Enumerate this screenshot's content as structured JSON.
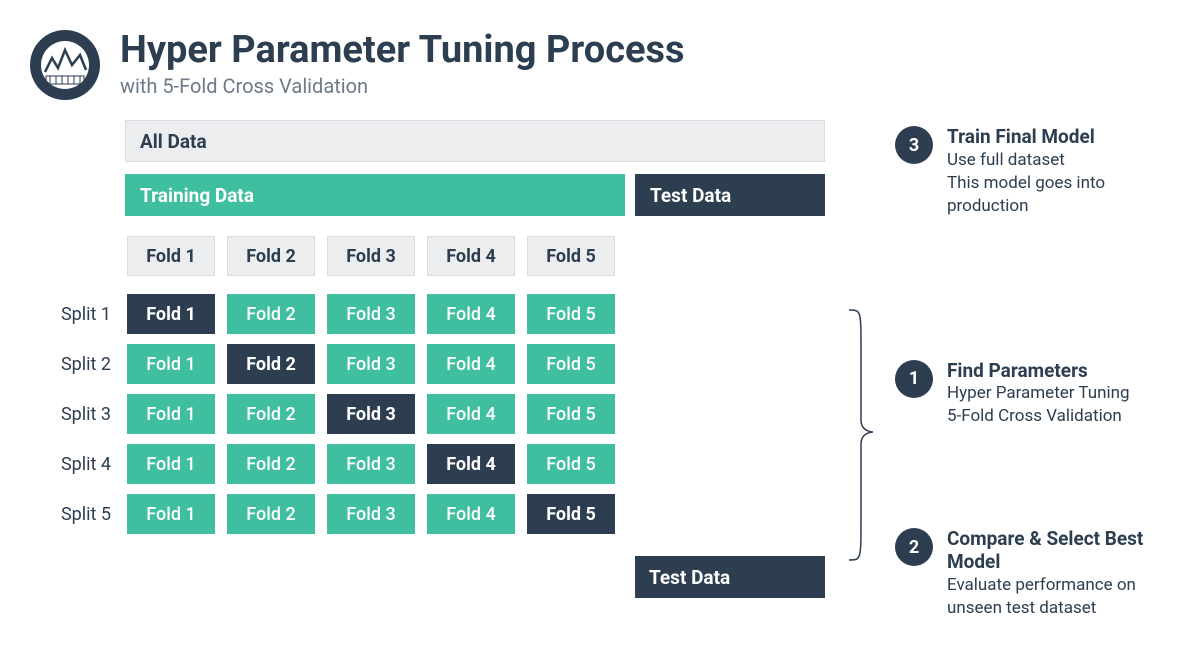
{
  "header": {
    "title": "Hyper Parameter Tuning Process",
    "subtitle": "with 5-Fold Cross Validation"
  },
  "rows": {
    "all_data": "All Data",
    "training_data": "Training Data",
    "test_data": "Test Data",
    "fold_headers": [
      "Fold 1",
      "Fold 2",
      "Fold 3",
      "Fold 4",
      "Fold 5"
    ],
    "splits": [
      {
        "label": "Split 1",
        "highlight_index": 0
      },
      {
        "label": "Split 2",
        "highlight_index": 1
      },
      {
        "label": "Split 3",
        "highlight_index": 2
      },
      {
        "label": "Split 4",
        "highlight_index": 3
      },
      {
        "label": "Split 5",
        "highlight_index": 4
      }
    ],
    "test_data_bottom": "Test Data"
  },
  "callouts": {
    "c3": {
      "num": "3",
      "title": "Train Final Model",
      "line1": "Use full dataset",
      "line2": "This model goes into production"
    },
    "c1": {
      "num": "1",
      "title": "Find Parameters",
      "line1": "Hyper Parameter Tuning",
      "line2": "5-Fold Cross Validation"
    },
    "c2": {
      "num": "2",
      "title": "Compare & Select Best Model",
      "line1": "Evaluate performance on unseen test dataset",
      "line2": ""
    }
  }
}
